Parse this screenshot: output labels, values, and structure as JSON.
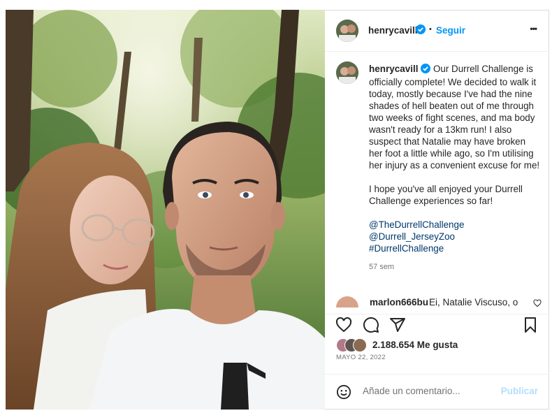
{
  "post": {
    "username": "henrycavill",
    "follow_label": "Seguir",
    "separator": "•",
    "more_label": "•••",
    "caption_p1": "Our Durrell Challenge is officially complete! We decided to walk it today, mostly because I've had the nine shades of hell beaten out of me through two weeks of fight scenes, and ma body wasn't ready for a 13km run! I also suspect that Natalie may have broken her foot a little while ago, so I'm utilising her injury as a convenient excuse for me!",
    "caption_p2": "I hope you've all enjoyed your Durrell Challenge experiences so far!",
    "tags": [
      "@TheDurrellChallenge",
      "@Durrell_JerseyZoo",
      "#DurrellChallenge"
    ],
    "time_ago": "57 sem",
    "comment_username": "marlon666bu",
    "comment_text": "Ei, Natalie Viscuso, o",
    "likes": "2.188.654 Me gusta",
    "date": "MAYO 22, 2022",
    "comment_placeholder": "Añade un comentario...",
    "publish_label": "Publicar"
  },
  "colors": {
    "accent": "#0095f6",
    "verified": "#0095f6",
    "link": "#00376b",
    "muted": "#737373"
  }
}
